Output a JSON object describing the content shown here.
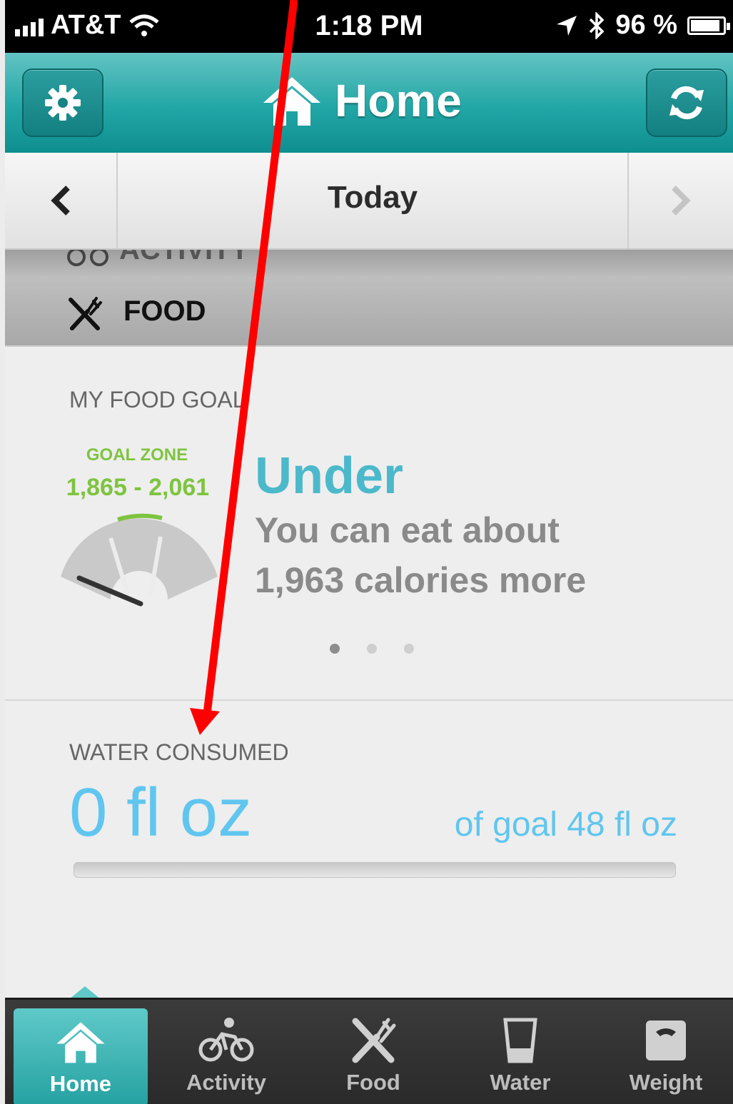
{
  "status_bar": {
    "carrier": "AT&T",
    "time": "1:18 PM",
    "battery": "96 %"
  },
  "header": {
    "title": "Home"
  },
  "date_nav": {
    "label": "Today"
  },
  "sections": {
    "activity_partial": "ACTIVITY",
    "food": "FOOD"
  },
  "food_goal": {
    "caption": "MY FOOD GOAL",
    "zone_label": "GOAL ZONE",
    "zone_range": "1,865 - 2,061",
    "status": "Under",
    "message_line1": "You can eat about",
    "message_line2": "1,963 calories more",
    "pager_pages": 3,
    "pager_active": 0
  },
  "water": {
    "caption": "WATER CONSUMED",
    "value": "0 fl oz",
    "goal": "of goal 48 fl oz",
    "progress_fraction": 0
  },
  "tabs": [
    {
      "label": "Home",
      "icon": "home-icon",
      "active": true
    },
    {
      "label": "Activity",
      "icon": "bicycle-icon",
      "active": false
    },
    {
      "label": "Food",
      "icon": "fork-knife-icon",
      "active": false
    },
    {
      "label": "Water",
      "icon": "water-glass-icon",
      "active": false
    },
    {
      "label": "Weight",
      "icon": "scale-icon",
      "active": false
    }
  ],
  "colors": {
    "header_teal": "#22a6a6",
    "goal_green": "#7ec43f",
    "status_blue": "#4cb9cb",
    "water_blue": "#60c6ef",
    "annotation_red": "#ff0000"
  }
}
